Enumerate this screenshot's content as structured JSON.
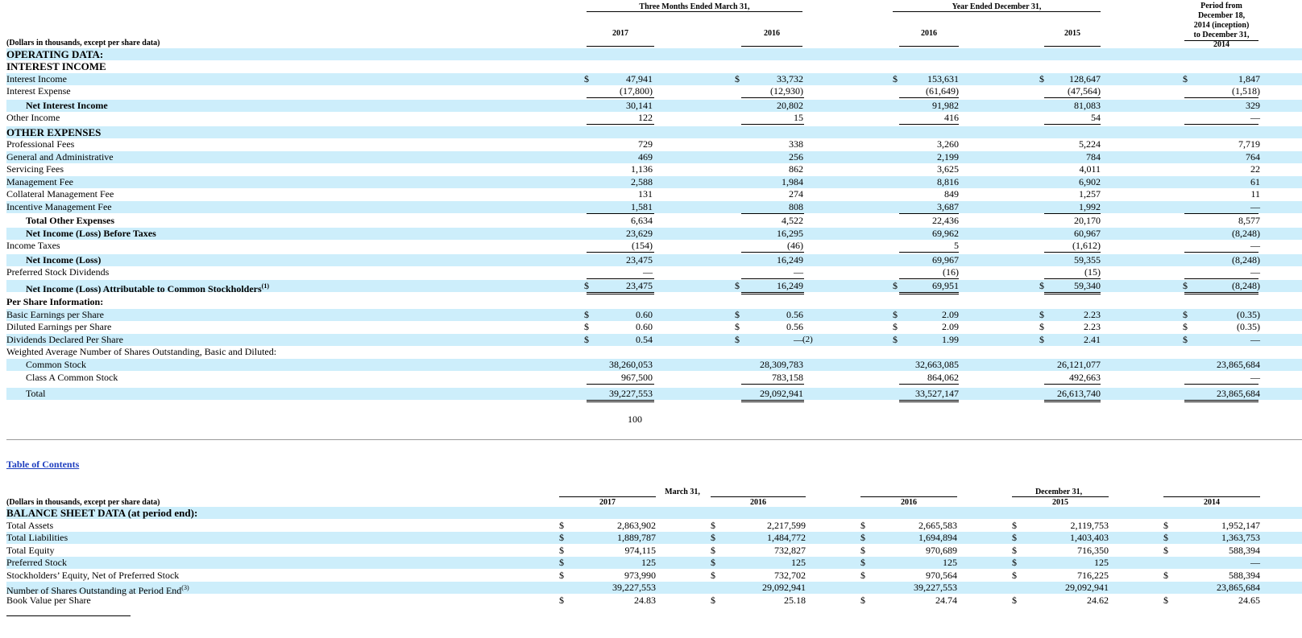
{
  "top": {
    "period_headers": [
      "Three Months Ended March 31,",
      "Year Ended December 31,"
    ],
    "year_headers": [
      "2017",
      "2016",
      "2016",
      "2015"
    ],
    "inception_header": [
      "Period from",
      "December 18,",
      "2014 (inception)",
      "to December 31,",
      "2014"
    ],
    "units_note": "(Dollars in thousands, except per share data)",
    "rows": [
      {
        "label": "OPERATING DATA:",
        "style": "sec",
        "bg": true
      },
      {
        "label": "INTEREST INCOME",
        "style": "sec",
        "bg": false
      },
      {
        "label": "Interest Income",
        "bg": true,
        "dollar": [
          true,
          true,
          true,
          true,
          true
        ],
        "values": [
          "47,941",
          "33,732",
          "153,631",
          "128,647",
          "1,847"
        ]
      },
      {
        "label": "Interest Expense",
        "bg": false,
        "under": true,
        "values": [
          "(17,800)",
          "(12,930)",
          "(61,649)",
          "(47,564)",
          "(1,518)"
        ]
      },
      {
        "label": "Net Interest Income",
        "style": "b",
        "indent": true,
        "bg": true,
        "values": [
          "30,141",
          "20,802",
          "91,982",
          "81,083",
          "329"
        ]
      },
      {
        "label": "Other Income",
        "bg": false,
        "under": true,
        "values": [
          "122",
          "15",
          "416",
          "54",
          "—"
        ]
      },
      {
        "label": "OTHER EXPENSES",
        "style": "sec",
        "bg": true
      },
      {
        "label": "Professional Fees",
        "bg": false,
        "values": [
          "729",
          "338",
          "3,260",
          "5,224",
          "7,719"
        ]
      },
      {
        "label": "General and Administrative",
        "bg": true,
        "values": [
          "469",
          "256",
          "2,199",
          "784",
          "764"
        ]
      },
      {
        "label": "Servicing Fees",
        "bg": false,
        "values": [
          "1,136",
          "862",
          "3,625",
          "4,011",
          "22"
        ]
      },
      {
        "label": "Management Fee",
        "bg": true,
        "values": [
          "2,588",
          "1,984",
          "8,816",
          "6,902",
          "61"
        ]
      },
      {
        "label": "Collateral Management Fee",
        "bg": false,
        "values": [
          "131",
          "274",
          "849",
          "1,257",
          "11"
        ]
      },
      {
        "label": "Incentive Management Fee",
        "bg": true,
        "under": true,
        "values": [
          "1,581",
          "808",
          "3,687",
          "1,992",
          "—"
        ]
      },
      {
        "label": "Total Other Expenses",
        "style": "b",
        "indent": true,
        "bg": false,
        "values": [
          "6,634",
          "4,522",
          "22,436",
          "20,170",
          "8,577"
        ]
      },
      {
        "label": "Net Income (Loss) Before Taxes",
        "style": "b",
        "indent": true,
        "bg": true,
        "values": [
          "23,629",
          "16,295",
          "69,962",
          "60,967",
          "(8,248)"
        ]
      },
      {
        "label": "Income Taxes",
        "bg": false,
        "under": true,
        "values": [
          "(154)",
          "(46)",
          "5",
          "(1,612)",
          "—"
        ]
      },
      {
        "label": "Net Income (Loss)",
        "style": "b",
        "indent": true,
        "bg": true,
        "values": [
          "23,475",
          "16,249",
          "69,967",
          "59,355",
          "(8,248)"
        ]
      },
      {
        "label": "Preferred Stock Dividends",
        "bg": false,
        "under": true,
        "values": [
          "—",
          "—",
          "(16)",
          "(15)",
          "—"
        ]
      },
      {
        "label": "Net Income (Loss) Attributable to Common Stockholders",
        "sup": "(1)",
        "style": "b",
        "indent": true,
        "bg": true,
        "double": true,
        "dollar": [
          true,
          true,
          true,
          true,
          true
        ],
        "values": [
          "23,475",
          "16,249",
          "69,951",
          "59,340",
          "(8,248)"
        ]
      },
      {
        "label": "Per Share Information:",
        "style": "b",
        "bg": false
      },
      {
        "label": "Basic Earnings per Share",
        "bg": true,
        "dollar": [
          true,
          true,
          true,
          true,
          true
        ],
        "values": [
          "0.60",
          "0.56",
          "2.09",
          "2.23",
          "(0.35)"
        ]
      },
      {
        "label": "Diluted Earnings per Share",
        "bg": false,
        "dollar": [
          true,
          true,
          true,
          true,
          true
        ],
        "values": [
          "0.60",
          "0.56",
          "2.09",
          "2.23",
          "(0.35)"
        ]
      },
      {
        "label": "Dividends Declared Per Share",
        "bg": true,
        "dollar": [
          true,
          true,
          true,
          true,
          true
        ],
        "values": [
          "0.54",
          "—",
          "1.99",
          "2.41",
          "—"
        ],
        "note2": "(2)"
      },
      {
        "label": "Weighted Average Number of Shares Outstanding, Basic and Diluted:",
        "bg": false
      },
      {
        "label": "Common Stock",
        "indent": true,
        "bg": true,
        "values": [
          "38,260,053",
          "28,309,783",
          "32,663,085",
          "26,121,077",
          "23,865,684"
        ]
      },
      {
        "label": "Class A Common Stock",
        "indent": true,
        "bg": false,
        "under": true,
        "values": [
          "967,500",
          "783,158",
          "864,062",
          "492,663",
          "—"
        ]
      },
      {
        "label": "Total",
        "indent": true,
        "bg": true,
        "double": true,
        "values": [
          "39,227,553",
          "29,092,941",
          "33,527,147",
          "26,613,740",
          "23,865,684"
        ]
      }
    ]
  },
  "page_number": "100",
  "toc_link": "Table of Contents",
  "bottom": {
    "period_headers": [
      "March 31,",
      "December 31,"
    ],
    "year_headers": [
      "2017",
      "2016",
      "2016",
      "2015",
      "2014"
    ],
    "units_note": "(Dollars in thousands, except per share data)",
    "rows": [
      {
        "label": "BALANCE SHEET DATA (at period end):",
        "style": "sec",
        "bg": true
      },
      {
        "label": "Total Assets",
        "bg": false,
        "dollar": [
          true,
          true,
          true,
          true,
          true
        ],
        "values": [
          "2,863,902",
          "2,217,599",
          "2,665,583",
          "2,119,753",
          "1,952,147"
        ]
      },
      {
        "label": "Total Liabilities",
        "bg": true,
        "dollar": [
          true,
          true,
          true,
          true,
          true
        ],
        "values": [
          "1,889,787",
          "1,484,772",
          "1,694,894",
          "1,403,403",
          "1,363,753"
        ]
      },
      {
        "label": "Total Equity",
        "bg": false,
        "dollar": [
          true,
          true,
          true,
          true,
          true
        ],
        "values": [
          "974,115",
          "732,827",
          "970,689",
          "716,350",
          "588,394"
        ]
      },
      {
        "label": "Preferred Stock",
        "bg": true,
        "dollar": [
          true,
          true,
          true,
          true,
          false
        ],
        "values": [
          "125",
          "125",
          "125",
          "125",
          "—"
        ]
      },
      {
        "label": "Stockholders’ Equity, Net of Preferred Stock",
        "bg": false,
        "dollar": [
          true,
          true,
          true,
          true,
          true
        ],
        "values": [
          "973,990",
          "732,702",
          "970,564",
          "716,225",
          "588,394"
        ]
      },
      {
        "label": "Number of Shares Outstanding at Period End",
        "sup": "(3)",
        "bg": true,
        "values": [
          "39,227,553",
          "29,092,941",
          "39,227,553",
          "29,092,941",
          "23,865,684"
        ]
      },
      {
        "label": "Book Value per Share",
        "bg": false,
        "dollar": [
          true,
          true,
          true,
          true,
          true
        ],
        "values": [
          "24.83",
          "25.18",
          "24.74",
          "24.62",
          "24.65"
        ]
      }
    ]
  }
}
